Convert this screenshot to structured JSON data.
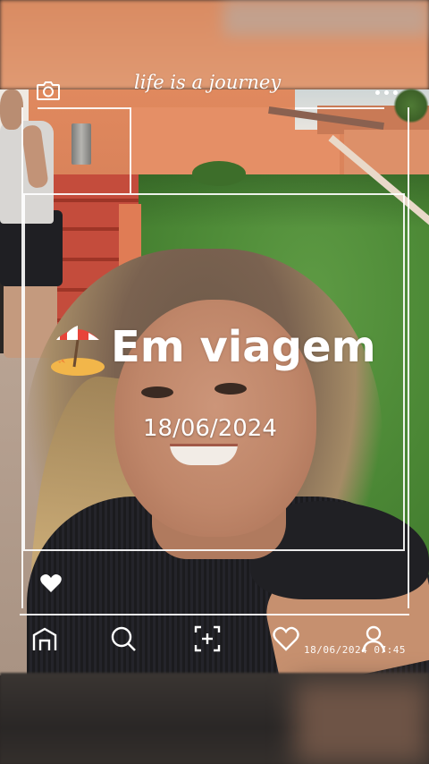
{
  "overlay": {
    "tagline": "life is a journey",
    "title": "Em viagem",
    "date": "18/06/2024",
    "timestamp": "18/06/2024 07:45",
    "menu_dots": "•••"
  },
  "icons": {
    "camera": "camera-icon",
    "home": "home-icon",
    "search": "search-icon",
    "add": "add-frame-icon",
    "like": "heart-outline-icon",
    "profile": "profile-icon",
    "heart_filled": "heart-icon",
    "emoji": "beach-umbrella-icon"
  },
  "colors": {
    "overlay_white": "#ffffff",
    "wall_orange": "#e0895e",
    "grass_green": "#4f8c38",
    "stairs_red": "#c44c3c"
  }
}
